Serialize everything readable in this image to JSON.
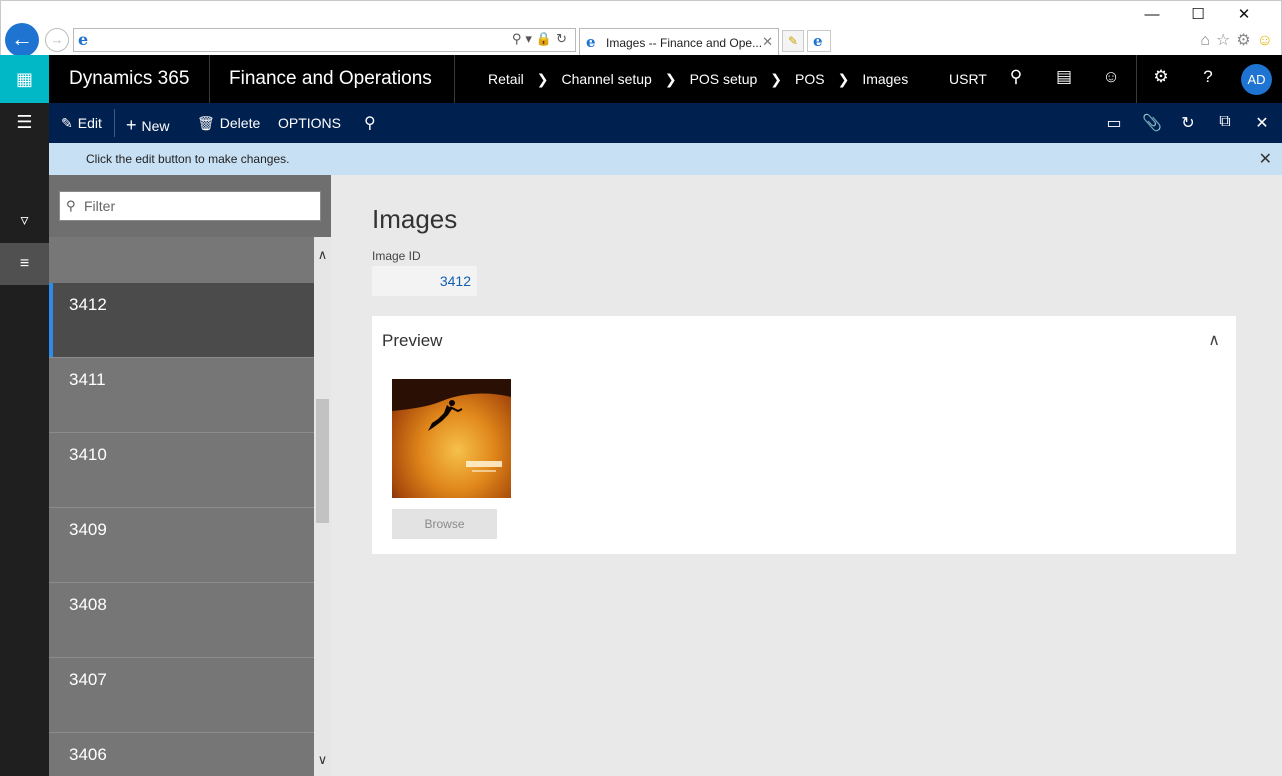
{
  "browser": {
    "tab_title": "Images -- Finance and Ope...",
    "back_icon": "arrow-left-icon",
    "forward_icon": "arrow-right-icon"
  },
  "navbar": {
    "product": "Dynamics 365",
    "module": "Finance and Operations",
    "breadcrumb": [
      "Retail",
      "Channel setup",
      "POS setup",
      "POS",
      "Images"
    ],
    "company": "USRT",
    "avatar_initials": "AD"
  },
  "actions": {
    "edit": "Edit",
    "new": "New",
    "delete": "Delete",
    "options": "OPTIONS"
  },
  "info": {
    "message": "Click the edit button to make changes."
  },
  "list": {
    "filter_placeholder": "Filter",
    "items": [
      "3412",
      "3411",
      "3410",
      "3409",
      "3408",
      "3407",
      "3406"
    ],
    "selected": "3412"
  },
  "detail": {
    "title": "Images",
    "image_id_label": "Image ID",
    "image_id_value": "3412",
    "preview_title": "Preview",
    "browse_label": "Browse"
  },
  "colors": {
    "accent": "#01b8c7",
    "action_bar": "#002050",
    "info_bar": "#c7e0f4",
    "selected_marker": "#2e8be8",
    "link": "#1260b3"
  }
}
